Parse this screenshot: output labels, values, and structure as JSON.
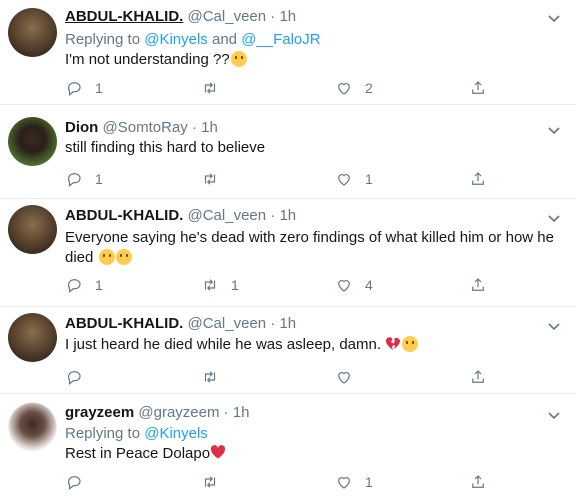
{
  "tweets": [
    {
      "name": "ABDUL-KHALID.",
      "handle": "@Cal_veen",
      "sep": "·",
      "time": "1h",
      "replying_prefix": "Replying to ",
      "replying_a": "@Kinyels",
      "replying_and": " and ",
      "replying_b": "@__FaloJR",
      "text": "I'm not understanding ??",
      "reply_count": "1",
      "retweet_count": "",
      "like_count": "2"
    },
    {
      "name": "Dion",
      "handle": "@SomtoRay",
      "sep": "·",
      "time": "1h",
      "text": "still finding this hard to believe",
      "reply_count": "1",
      "retweet_count": "",
      "like_count": "1"
    },
    {
      "name": "ABDUL-KHALID.",
      "handle": "@Cal_veen",
      "sep": "·",
      "time": "1h",
      "text_line1": "Everyone  saying he's dead with zero findings of what killed him or how he",
      "text_line2": "died",
      "reply_count": "1",
      "retweet_count": "1",
      "like_count": "4"
    },
    {
      "name": "ABDUL-KHALID.",
      "handle": "@Cal_veen",
      "sep": "·",
      "time": "1h",
      "text": "I just heard he died while he was asleep, damn.",
      "reply_count": "",
      "retweet_count": "",
      "like_count": ""
    },
    {
      "name": "grayzeem",
      "handle": "@grayzeem",
      "sep": "·",
      "time": "1h",
      "replying_prefix": "Replying to ",
      "replying_a": "@Kinyels",
      "text": "Rest in Peace Dolapo",
      "reply_count": "",
      "retweet_count": "",
      "like_count": "1"
    }
  ],
  "colors": {
    "accent": "#1da1f2",
    "muted": "#657786",
    "text": "#14171a",
    "divider": "#e6ecf0"
  },
  "icons": [
    "reply-icon",
    "retweet-icon",
    "like-icon",
    "share-icon",
    "chevron-down-icon"
  ]
}
